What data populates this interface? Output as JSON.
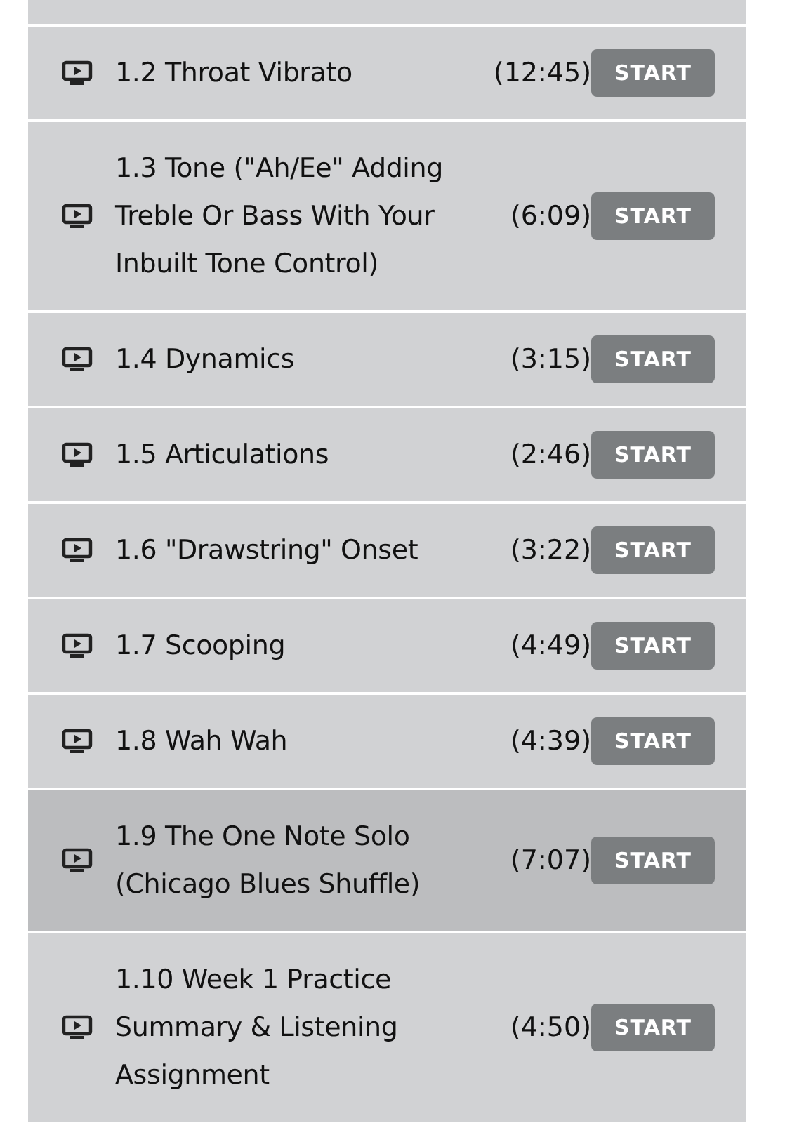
{
  "lessons": [
    {
      "title": "1.2 Throat Vibrato",
      "duration": "(12:45)",
      "button": "START",
      "selected": false
    },
    {
      "title": "1.3 Tone (\"Ah/Ee\" Adding Treble Or Bass With Your Inbuilt Tone Control)",
      "duration": "(6:09)",
      "button": "START",
      "selected": false
    },
    {
      "title": "1.4 Dynamics",
      "duration": "(3:15)",
      "button": "START",
      "selected": false
    },
    {
      "title": "1.5 Articulations",
      "duration": "(2:46)",
      "button": "START",
      "selected": false
    },
    {
      "title": "1.6 \"Drawstring\" Onset",
      "duration": "(3:22)",
      "button": "START",
      "selected": false
    },
    {
      "title": "1.7 Scooping",
      "duration": "(4:49)",
      "button": "START",
      "selected": false
    },
    {
      "title": "1.8 Wah Wah",
      "duration": "(4:39)",
      "button": "START",
      "selected": false
    },
    {
      "title": "1.9 The One Note Solo (Chicago Blues Shuffle)",
      "duration": "(7:07)",
      "button": "START",
      "selected": true
    },
    {
      "title": "1.10 Week 1 Practice Summary & Listening Assignment",
      "duration": "(4:50)",
      "button": "START",
      "selected": false
    }
  ]
}
